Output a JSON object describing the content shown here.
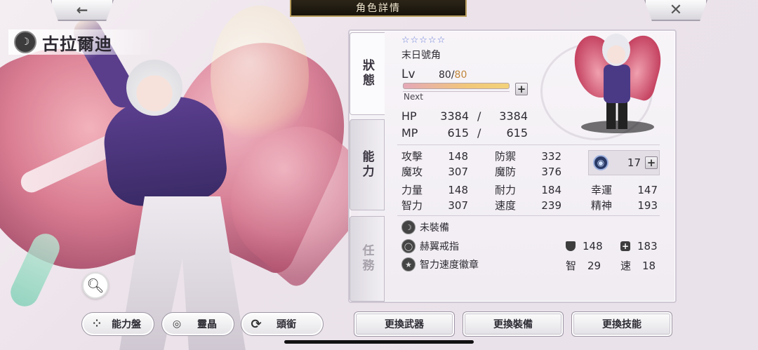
{
  "header": {
    "title": "角色詳情",
    "back_icon": "←",
    "close_icon": "✕"
  },
  "character": {
    "name": "古拉爾迪"
  },
  "tabs": [
    {
      "label": "狀態"
    },
    {
      "label": "能力"
    },
    {
      "label": "任務"
    }
  ],
  "status": {
    "stars": "☆☆☆☆☆",
    "title": "末日號角",
    "lv_label": "Lv",
    "lv_current": "80/",
    "lv_max": "80",
    "next_label": "Next",
    "hp_label": "HP",
    "hp_current": "3384",
    "hp_max": "3384",
    "mp_label": "MP",
    "mp_current": "615",
    "mp_max": "615",
    "slash": "/"
  },
  "stats": {
    "attack_label": "攻擊",
    "attack": "148",
    "defense_label": "防禦",
    "defense": "332",
    "mattack_label": "魔攻",
    "mattack": "307",
    "mdefense_label": "魔防",
    "mdefense": "376",
    "strength_label": "力量",
    "strength": "148",
    "stamina_label": "耐力",
    "stamina": "184",
    "luck_label": "幸運",
    "luck": "147",
    "intellect_label": "智力",
    "intellect": "307",
    "speed_label": "速度",
    "speed": "239",
    "spirit_label": "精神",
    "spirit": "193",
    "crest_value": "17"
  },
  "equipment": [
    {
      "label": "未裝備"
    },
    {
      "label": "赫翼戒指"
    },
    {
      "label": "智力速度徽章"
    }
  ],
  "equip_stats": {
    "def_value": "148",
    "hp_value": "183",
    "int_label": "智",
    "int_value": "29",
    "spd_label": "速",
    "spd_value": "18"
  },
  "left_buttons": {
    "ability_board": "能力盤",
    "spirit_crystal": "靈晶",
    "honorific": "頭銜"
  },
  "bottom_buttons": {
    "change_weapon": "更換武器",
    "change_gear": "更換裝備",
    "change_skill": "更換技能"
  },
  "colors": {
    "title_bar": "#1d1810",
    "title_border": "#b59b5c",
    "star_color": "#6a7fd6",
    "lv_max_color": "#c0863a"
  }
}
